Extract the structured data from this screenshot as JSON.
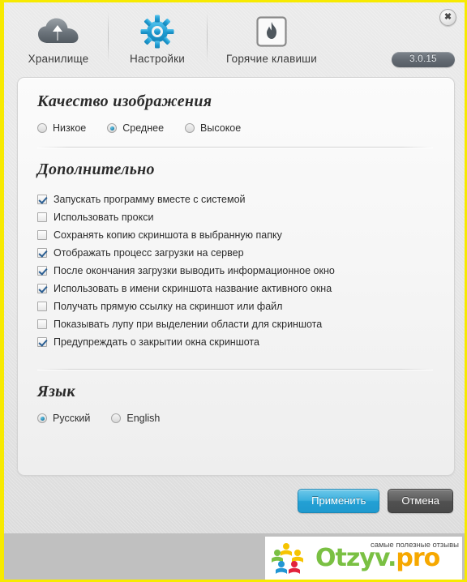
{
  "window": {
    "close_label": "✖",
    "version": "3.0.15"
  },
  "toolbar": {
    "items": [
      {
        "label": "Хранилище",
        "icon": "cloud-upload-icon"
      },
      {
        "label": "Настройки",
        "icon": "gear-icon"
      },
      {
        "label": "Горячие клавиши",
        "icon": "flame-icon"
      }
    ]
  },
  "quality": {
    "title": "Качество изображения",
    "options": [
      {
        "label": "Низкое",
        "checked": false
      },
      {
        "label": "Среднее",
        "checked": true
      },
      {
        "label": "Высокое",
        "checked": false
      }
    ]
  },
  "additional": {
    "title": "Дополнительно",
    "options": [
      {
        "label": "Запускать программу вместе с системой",
        "checked": true
      },
      {
        "label": "Использовать прокси",
        "checked": false
      },
      {
        "label": "Сохранять копию скриншота в выбранную папку",
        "checked": false
      },
      {
        "label": "Отображать процесс загрузки на сервер",
        "checked": true
      },
      {
        "label": "После окончания загрузки выводить информационное окно",
        "checked": true
      },
      {
        "label": "Использовать в имени скриншота название активного окна",
        "checked": true
      },
      {
        "label": "Получать прямую ссылку на скриншот или файл",
        "checked": false
      },
      {
        "label": "Показывать лупу при выделении области для скриншота",
        "checked": false
      },
      {
        "label": "Предупреждать о закрытии окна скриншота",
        "checked": true
      }
    ]
  },
  "language": {
    "title": "Язык",
    "options": [
      {
        "label": "Русский",
        "checked": true
      },
      {
        "label": "English",
        "checked": false
      }
    ]
  },
  "footer": {
    "apply_label": "Применить",
    "cancel_label": "Отмена"
  },
  "watermark": {
    "tagline": "самые полезные отзывы",
    "name_green": "Otzyv.",
    "name_orange": "pro"
  },
  "colors": {
    "accent_blue": "#23a0d4",
    "frame_yellow": "#f7ea00",
    "logo_green": "#7ac043",
    "logo_orange": "#f6a800"
  }
}
